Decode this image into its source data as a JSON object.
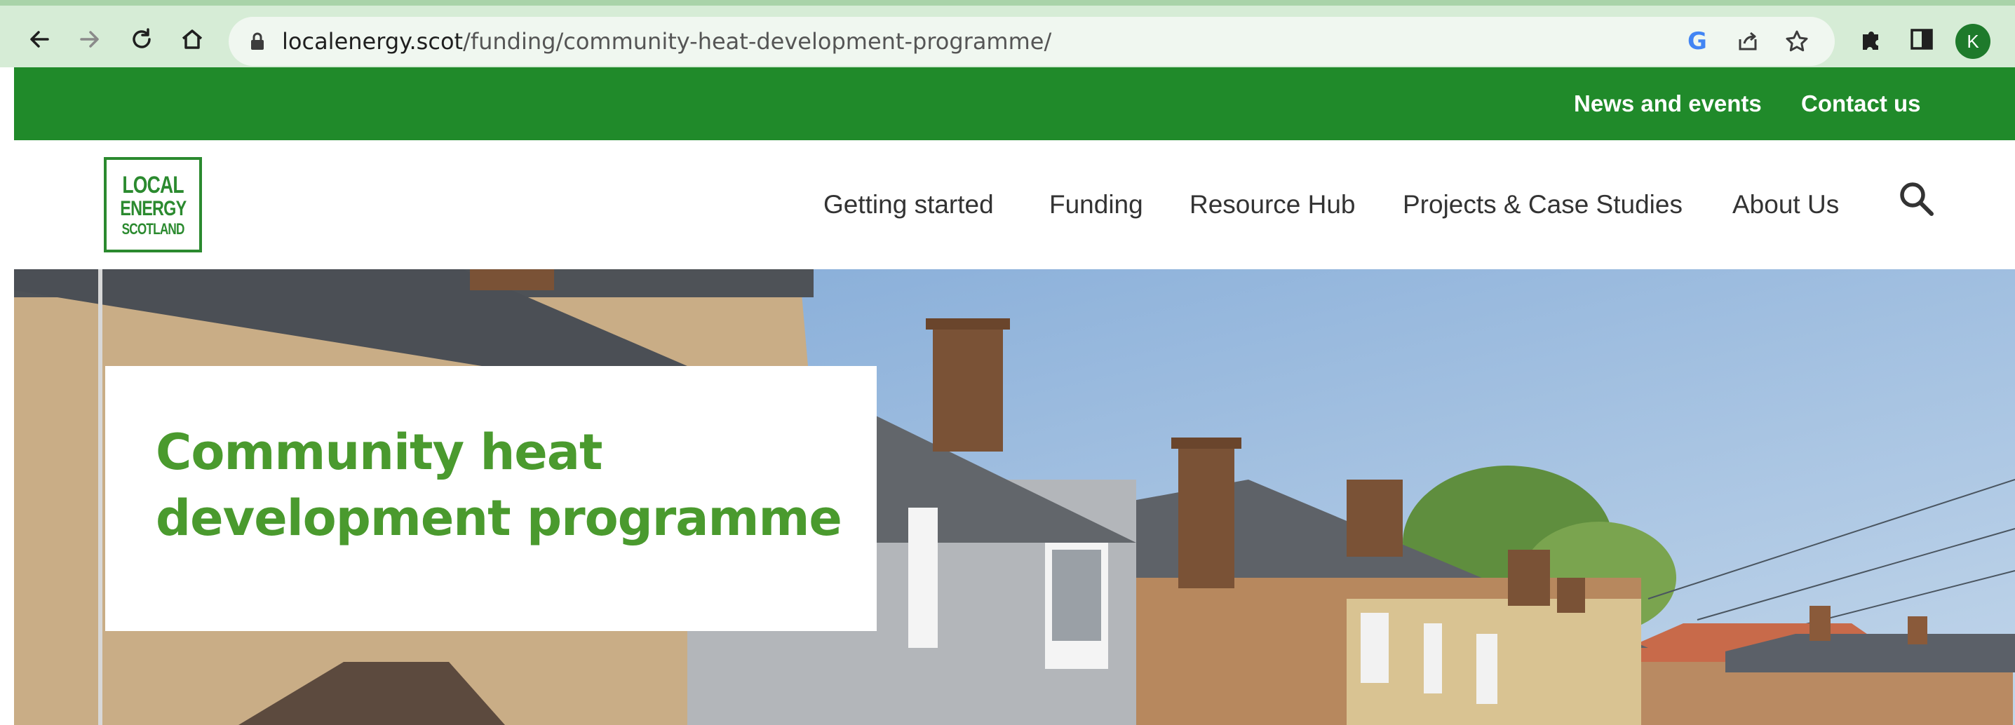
{
  "browser": {
    "url_host": "localenergy.scot",
    "url_path": "/funding/community-heat-development-programme/",
    "avatar_letter": "K",
    "icons": [
      "back-icon",
      "forward-icon",
      "reload-icon",
      "home-icon",
      "lock-icon",
      "google-icon",
      "share-icon",
      "bookmark-star-icon",
      "extensions-icon",
      "side-panel-icon"
    ]
  },
  "utility_nav": {
    "items": [
      {
        "label": "News and events"
      },
      {
        "label": "Contact us"
      }
    ]
  },
  "logo": {
    "line1": "LOCAL",
    "line2": "ENERGY",
    "line3": "SCOTLAND"
  },
  "main_nav": {
    "items": [
      {
        "label": "Getting started"
      },
      {
        "label": "Funding"
      },
      {
        "label": "Resource Hub"
      },
      {
        "label": "Projects & Case Studies"
      },
      {
        "label": "About Us"
      }
    ]
  },
  "hero": {
    "title": "Community heat development programme"
  },
  "colors": {
    "brand_green": "#208a2a",
    "title_green": "#4a9a2e",
    "chrome_bg": "#d6ecd6"
  }
}
